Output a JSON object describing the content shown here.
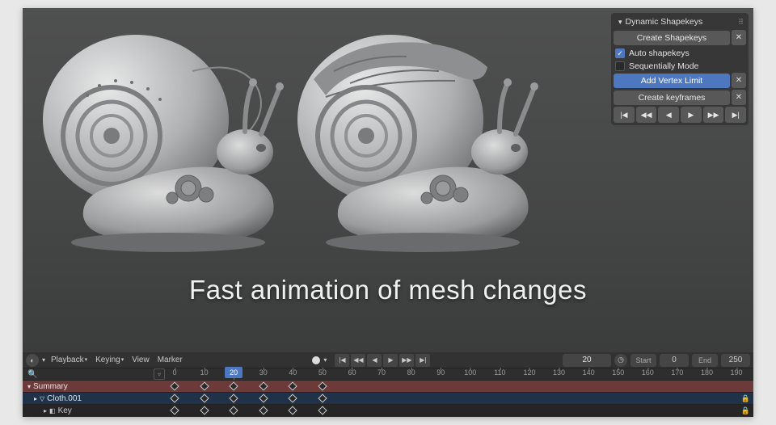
{
  "caption": "Fast animation of mesh changes",
  "panel": {
    "title": "Dynamic Shapekeys",
    "create_shapekeys": "Create Shapekeys",
    "auto_shapekeys": "Auto shapekeys",
    "sequentially_mode": "Sequentially Mode",
    "add_vertex_limit": "Add Vertex Limit",
    "create_keyframes": "Create keyframes",
    "close": "✕"
  },
  "timeline": {
    "menus": {
      "playback": "Playback",
      "keying": "Keying",
      "view": "View",
      "marker": "Marker"
    },
    "current_frame": "20",
    "start_label": "Start",
    "start_value": "0",
    "end_label": "End",
    "end_value": "250",
    "ticks": [
      "0",
      "10",
      "20",
      "30",
      "40",
      "50",
      "60",
      "70",
      "80",
      "90",
      "100",
      "110",
      "120",
      "130",
      "140",
      "150",
      "160",
      "170",
      "180",
      "190"
    ],
    "rows": {
      "summary": "Summary",
      "cloth": "Cloth.001",
      "key": "Key"
    },
    "keyframe_positions": [
      0,
      10,
      20,
      30,
      40,
      50
    ]
  }
}
